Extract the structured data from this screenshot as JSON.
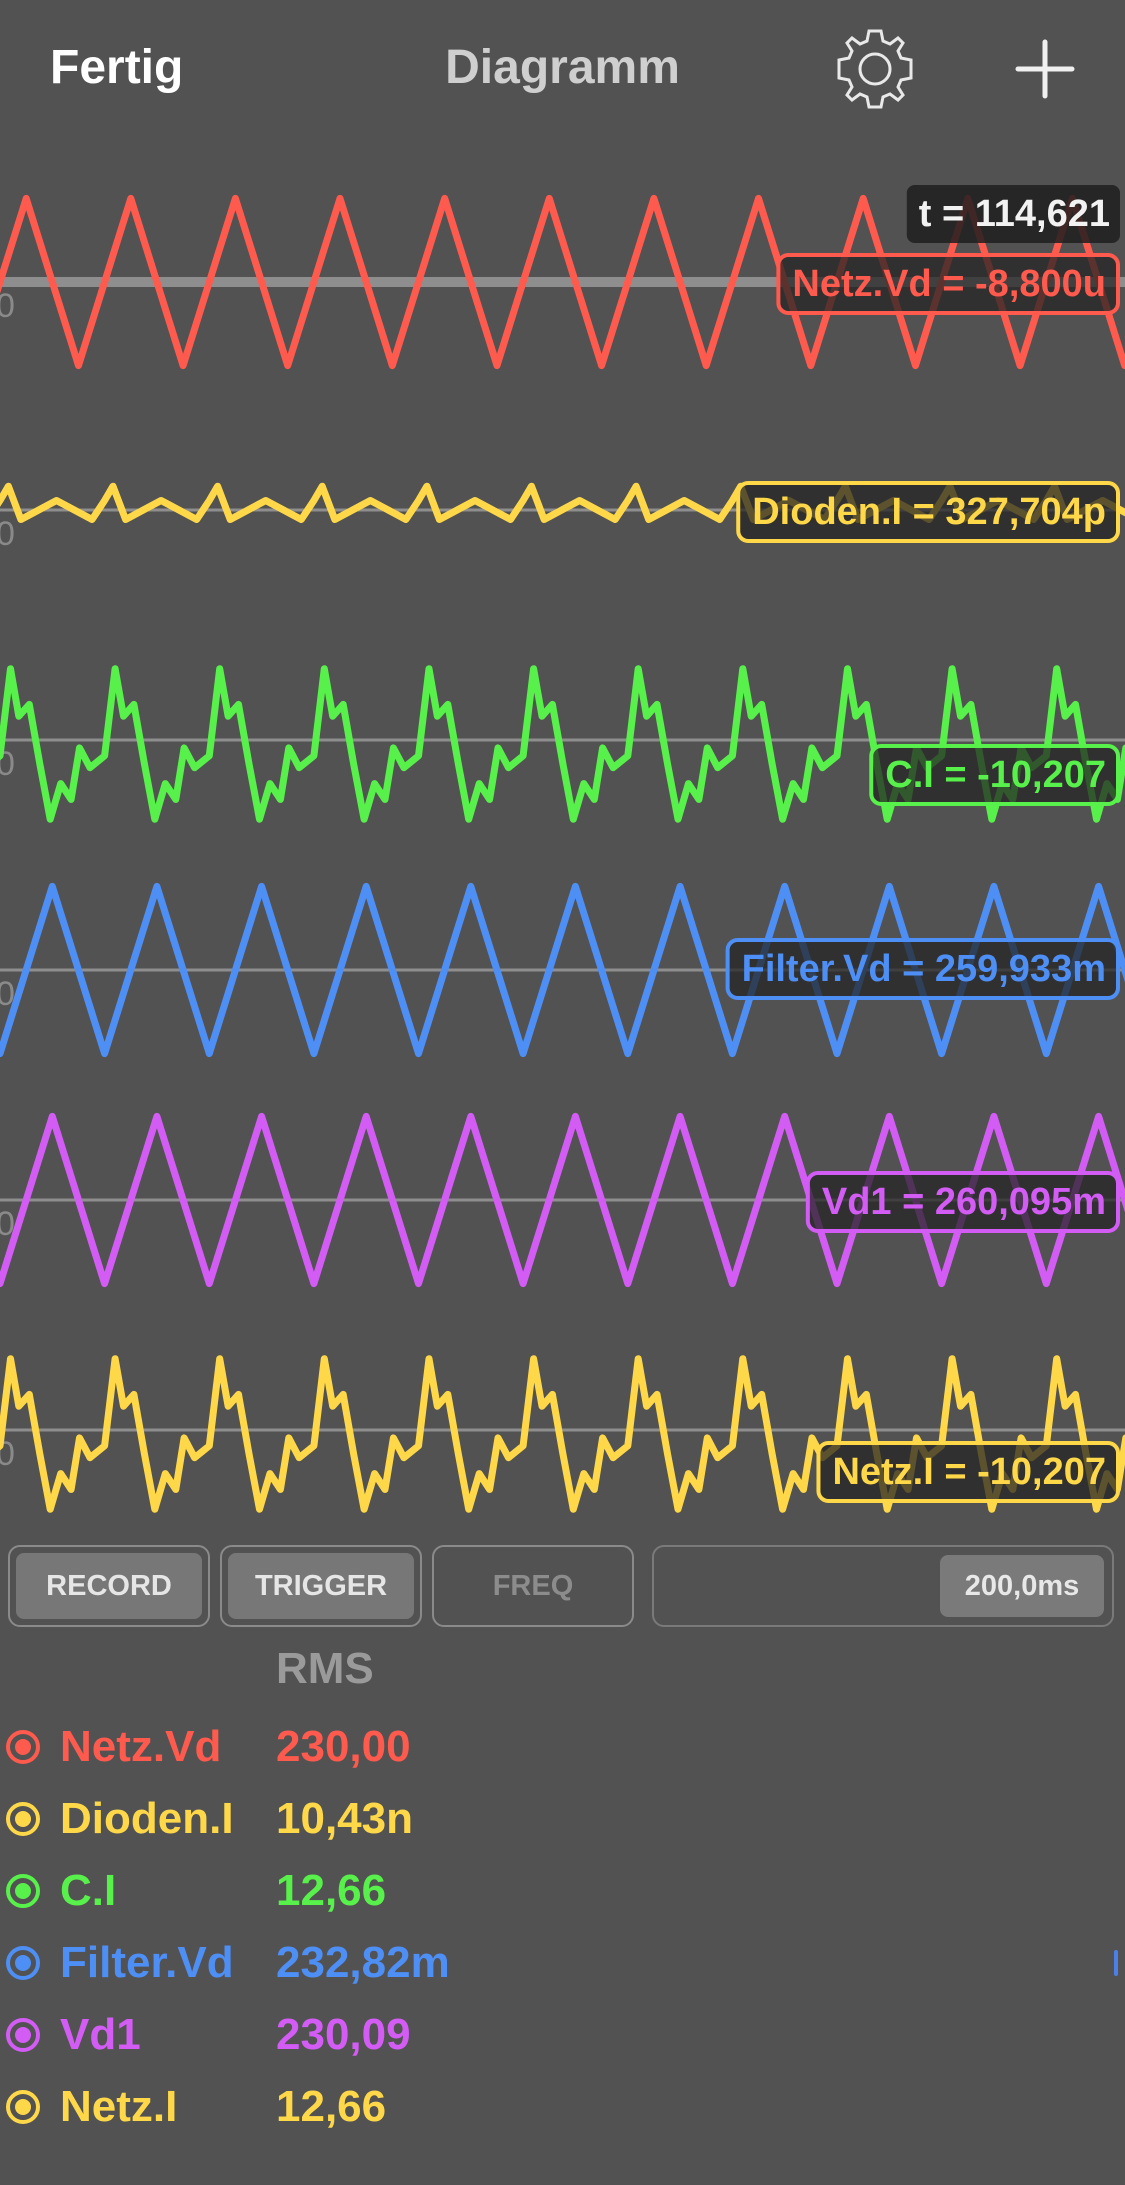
{
  "header": {
    "done_label": "Fertig",
    "title": "Diagramm"
  },
  "cursor": {
    "time_label": "t = 114,621"
  },
  "chart_data": {
    "type": "line",
    "title": "",
    "traces": [
      {
        "name": "Netz.Vd",
        "color": "#ff5a4e",
        "shape": "sine",
        "amp": 0.95,
        "cursor_label": "Netz.Vd = -8,800u",
        "rms": "230,00"
      },
      {
        "name": "Dioden.I",
        "color": "#ffd84a",
        "shape": "pulse",
        "amp": 0.9,
        "cursor_label": "Dioden.I = 327,704p",
        "rms": "10,43n"
      },
      {
        "name": "C.I",
        "color": "#58f04a",
        "shape": "ripple",
        "amp": 0.9,
        "cursor_label": "C.I = -10,207",
        "rms": "12,66"
      },
      {
        "name": "Filter.Vd",
        "color": "#4e8ff5",
        "shape": "tri",
        "amp": 0.95,
        "cursor_label": "Filter.Vd = 259,933m",
        "rms": "232,82m"
      },
      {
        "name": "Vd1",
        "color": "#d35cf5",
        "shape": "tri",
        "amp": 0.95,
        "cursor_label": "Vd1 = 260,095m",
        "rms": "230,09"
      },
      {
        "name": "Netz.I",
        "color": "#ffd84a",
        "shape": "ripple",
        "amp": 0.9,
        "cursor_label": "Netz.I = -10,207",
        "rms": "12,66"
      }
    ],
    "zero_label": "0",
    "cycles_visible": 10
  },
  "controls": {
    "record": "RECORD",
    "trigger": "TRIGGER",
    "freq": "FREQ",
    "timebase": "200,0ms"
  },
  "table": {
    "header": "RMS"
  }
}
